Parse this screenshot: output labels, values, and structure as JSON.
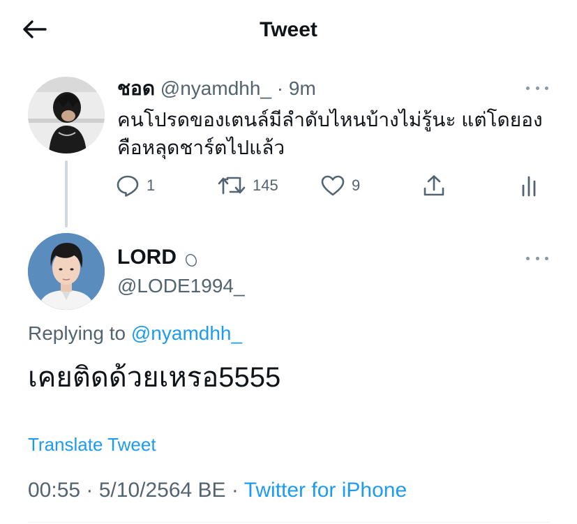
{
  "header": {
    "title": "Tweet",
    "back_icon": "arrow-left-icon"
  },
  "parent_tweet": {
    "name": "ชอด",
    "handle": "@nyamdhh_",
    "separator": "·",
    "time": "9m",
    "text": "คนโปรดของเตนล์มีลำดับไหนบ้างไม่รู้นะ แต่โดยองคือหลุดชาร์ตไปแล้ว",
    "actions": {
      "reply_count": "1",
      "retweet_count": "145",
      "like_count": "9"
    }
  },
  "main_tweet": {
    "name": "LORD",
    "handle": "@LODE1994_",
    "replying_prefix": "Replying to",
    "replying_handle": "@nyamdhh_",
    "text": "เคยติดด้วยเหรอ5555",
    "translate_label": "Translate Tweet",
    "timestamp": "00:55 · 5/10/2564 BE",
    "meta_separator": "·",
    "source": "Twitter for iPhone"
  },
  "colors": {
    "link": "#1d9bf0",
    "secondary_text": "#536471",
    "thread_line": "#cfd9de"
  }
}
